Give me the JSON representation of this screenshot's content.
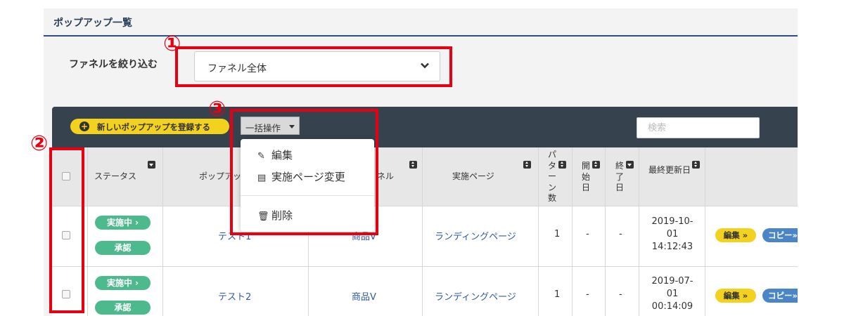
{
  "page_title": "ポップアップ一覧",
  "filter": {
    "label": "ファネルを絞り込む",
    "selected": "ファネル全体"
  },
  "toolbar": {
    "new_button": "新しいポップアップを登録する",
    "bulk_button": "一括操作",
    "search_placeholder": "検索"
  },
  "bulk_menu": {
    "items": [
      {
        "label": "編集",
        "icon": "edit-icon"
      },
      {
        "label": "実施ページ変更",
        "icon": "calendar-icon"
      },
      {
        "label": "削除",
        "icon": "trash-icon"
      }
    ]
  },
  "table": {
    "headers": {
      "status": "ステータス",
      "popup": "ポップアップ",
      "funnel": "ネル",
      "page": "実施ページ",
      "patterns": "パターン数",
      "start": "開始日",
      "end": "終了日",
      "updated": "最終更新日"
    },
    "rows": [
      {
        "status": "実施中 ›",
        "approval": "承認",
        "popup": "テスト1",
        "funnel": "商品V",
        "page": "ランディングページ",
        "patterns": "1",
        "start": "-",
        "end": "-",
        "updated_date": "2019-10-",
        "updated_day": "01",
        "updated_time": "14:12:43",
        "edit": "編集 »",
        "copy": "コピー»"
      },
      {
        "status": "実施中 ›",
        "approval": "承認",
        "popup": "テスト2",
        "funnel": "商品V",
        "page": "ランディングページ",
        "patterns": "1",
        "start": "-",
        "end": "-",
        "updated_date": "2019-07-",
        "updated_day": "01",
        "updated_time": "00:14:09",
        "edit": "編集 »",
        "copy": "コピー»"
      }
    ]
  },
  "annotations": {
    "badge1": "①",
    "badge2": "②",
    "badge3": "③",
    "highlight_color": "#e60012"
  }
}
